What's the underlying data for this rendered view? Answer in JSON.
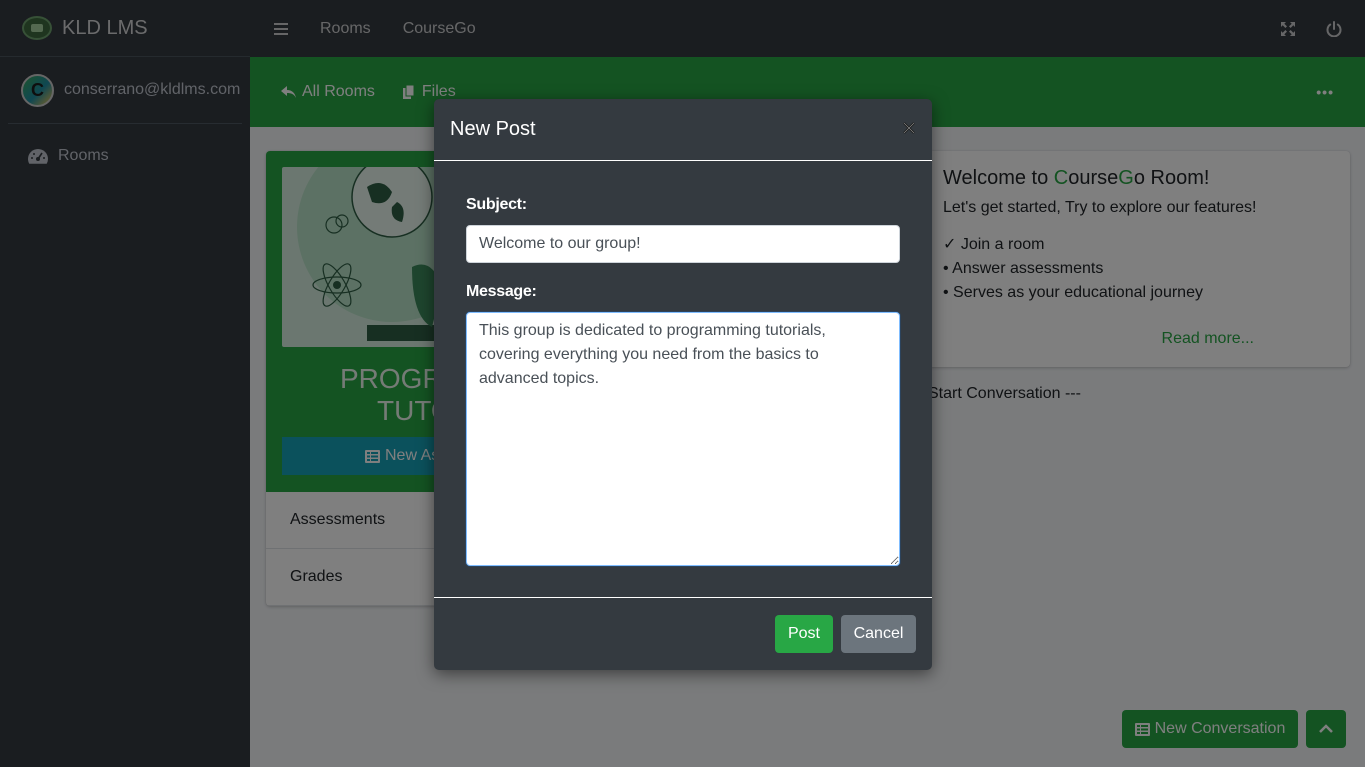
{
  "brand": {
    "name": "KLD LMS"
  },
  "user": {
    "initial": "C",
    "email": "conserrano@kldlms.com"
  },
  "sidebar": {
    "items": [
      {
        "label": "Rooms",
        "icon": "dashboard-icon"
      }
    ]
  },
  "topbar": {
    "links": [
      "Rooms",
      "CourseGo"
    ]
  },
  "room_nav": {
    "all_rooms": "All Rooms",
    "files": "Files"
  },
  "room": {
    "title_line1": "PROGRA",
    "title_line2": "TUTO",
    "new_assessment": "New As",
    "menu": [
      "Assessments",
      "Grades"
    ]
  },
  "welcome": {
    "title_prefix": "Welcome to ",
    "title_c": "C",
    "title_ourse": "ourse",
    "title_g": "G",
    "title_suffix": "o Room!",
    "subtitle": "Let's get started, Try to explore our features!",
    "items": [
      "✓ Join a room",
      "• Answer assessments",
      "• Serves as your educational journey"
    ],
    "read_more": "Read more..."
  },
  "start_conversation": "Start Conversation ---",
  "buttons": {
    "new_conversation": "New Conversation"
  },
  "modal": {
    "title": "New Post",
    "subject_label": "Subject:",
    "subject_value": "Welcome to our group!",
    "message_label": "Message:",
    "message_value": "This group is dedicated to programming tutorials, covering everything you need from the basics to advanced topics.",
    "post_label": "Post",
    "cancel_label": "Cancel"
  },
  "colors": {
    "accent": "#28a745",
    "dark": "#343a40",
    "info": "#17a2b8",
    "secondary": "#6c757d"
  }
}
